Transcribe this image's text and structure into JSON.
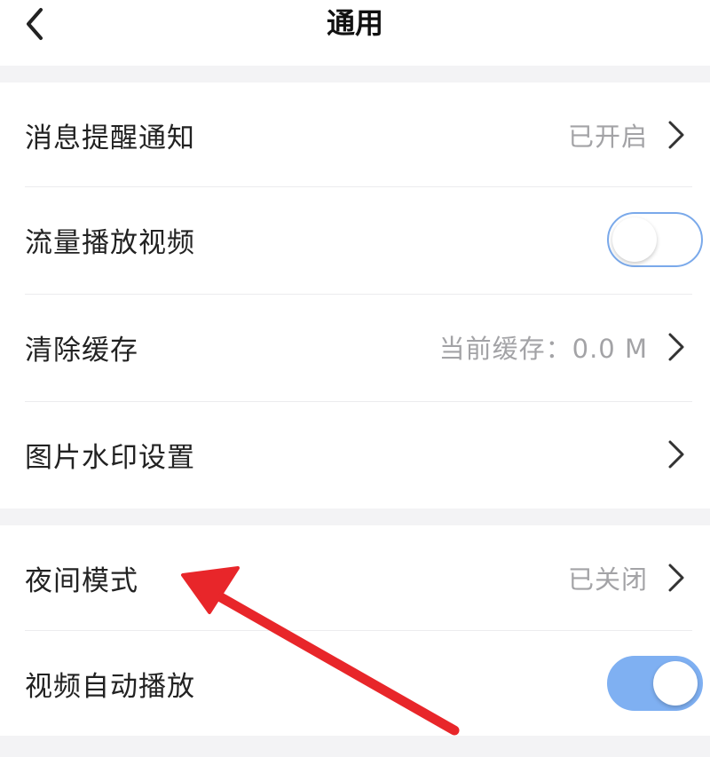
{
  "header": {
    "title": "通用"
  },
  "settings": {
    "group1": [
      {
        "label": "消息提醒通知",
        "value": "已开启",
        "control": "chevron"
      },
      {
        "label": "流量播放视频",
        "control": "toggle",
        "toggle_on": false
      },
      {
        "label": "清除缓存",
        "value": "当前缓存：0.0 M",
        "control": "chevron"
      },
      {
        "label": "图片水印设置",
        "value": "",
        "control": "chevron"
      }
    ],
    "group2": [
      {
        "label": "夜间模式",
        "value": "已关闭",
        "control": "chevron"
      },
      {
        "label": "视频自动播放",
        "control": "toggle",
        "toggle_on": true
      }
    ]
  },
  "colors": {
    "accent": "#7fb0f2",
    "annotation_arrow": "#e8262a",
    "secondary_text": "#a3a3a6",
    "section_background": "#f3f3f5"
  },
  "icons": {
    "back": "chevron-left-icon",
    "row_disclosure": "chevron-right-icon",
    "annotation": "red-arrow-icon"
  }
}
